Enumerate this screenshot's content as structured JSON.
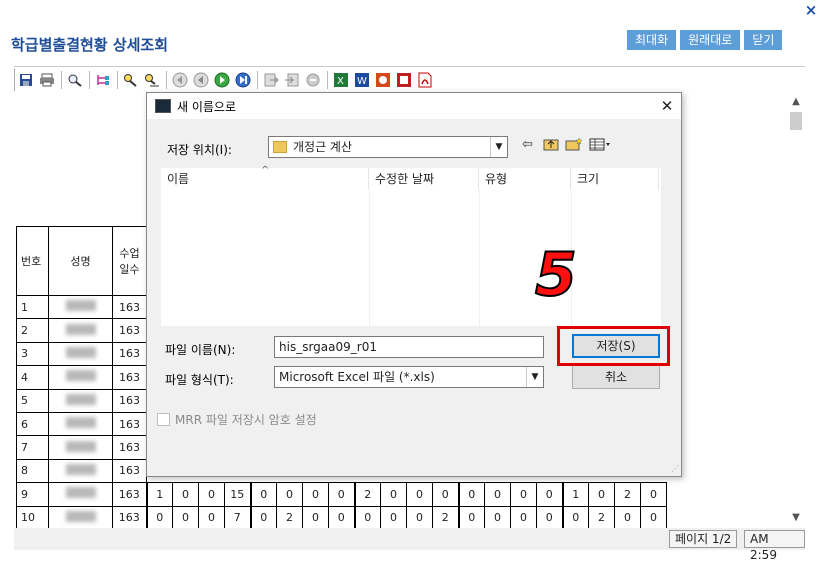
{
  "window": {
    "close_glyph": "×"
  },
  "page": {
    "title": "학급별출결현황 상세조회",
    "buttons": {
      "maximize": "최대화",
      "restore": "원래대로",
      "close": "닫기"
    }
  },
  "toolbar": {
    "icons": [
      "save-icon",
      "print-icon",
      "zoom-icon",
      "tree-icon",
      "search-icon",
      "search-next-icon",
      "first-page-icon",
      "prev-page-icon",
      "next-page-icon",
      "last-page-icon",
      "export-icon",
      "import-icon",
      "stop-icon",
      "excel-icon",
      "word-icon",
      "ppt-icon",
      "image-icon",
      "pdf-icon"
    ]
  },
  "status": {
    "page": "페이지 1/2",
    "time": "AM 2:59"
  },
  "report": {
    "headers": {
      "no": "번호",
      "name": "성명",
      "days_line1": "수업",
      "days_line2": "일수"
    },
    "rows": [
      {
        "no": "1",
        "days": "163"
      },
      {
        "no": "2",
        "days": "163"
      },
      {
        "no": "3",
        "days": "163"
      },
      {
        "no": "4",
        "days": "163"
      },
      {
        "no": "5",
        "days": "163"
      },
      {
        "no": "6",
        "days": "163"
      },
      {
        "no": "7",
        "days": "163"
      },
      {
        "no": "8",
        "days": "163"
      },
      {
        "no": "9",
        "days": "163",
        "cells": [
          "1",
          "0",
          "0",
          "15",
          "0",
          "0",
          "0",
          "0",
          "2",
          "0",
          "0",
          "0",
          "0",
          "0",
          "0",
          "0",
          "1",
          "0",
          "2",
          "0"
        ]
      },
      {
        "no": "10",
        "days": "163",
        "cells": [
          "0",
          "0",
          "0",
          "7",
          "0",
          "2",
          "0",
          "0",
          "0",
          "0",
          "0",
          "2",
          "0",
          "0",
          "0",
          "0",
          "0",
          "2",
          "0",
          "0"
        ]
      }
    ]
  },
  "dialog": {
    "title": "새 이름으로",
    "close_glyph": "✕",
    "location_label": "저장 위치(I):",
    "location_value": "개정근 계산",
    "columns": {
      "name": "이름",
      "modified": "수정한 날짜",
      "type": "유형",
      "size": "크기"
    },
    "filename_label": "파일 이름(N):",
    "filename_value": "his_srgaa09_r01",
    "filetype_label": "파일 형식(T):",
    "filetype_value": "Microsoft Excel 파일 (*.xls)",
    "save_button": "저장(S)",
    "cancel_button": "취소",
    "encrypt_label": "MRR 파일 저장시 암호 설정"
  },
  "annotation": {
    "step_number": "5",
    "highlight_color": "#e00000"
  }
}
